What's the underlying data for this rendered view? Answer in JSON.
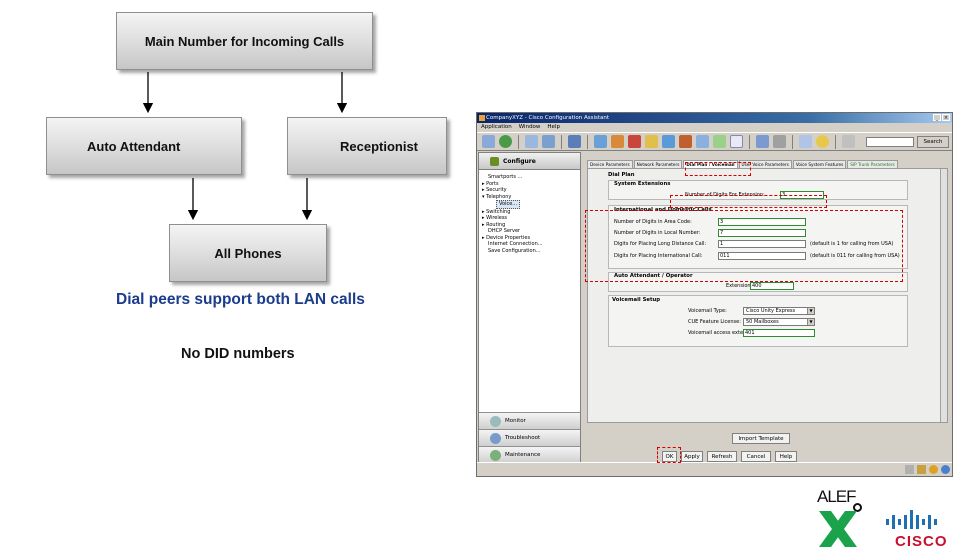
{
  "diagram": {
    "top_box": "Main Number for Incoming Calls",
    "left_box": "Auto Attendant",
    "right_box": "Receptionist",
    "bottom_box": "All Phones",
    "caption_blue": "Dial peers support both LAN calls",
    "caption_black": "No DID numbers"
  },
  "window": {
    "title": "CompanyXYZ - Cisco Configuration Assistant",
    "controls": [
      "_",
      "×"
    ],
    "menu": [
      "Application",
      "Window",
      "Help"
    ],
    "search_label": "Search",
    "nav": {
      "header": "Configure",
      "tree": [
        "Smartports ...",
        "Ports",
        "Security",
        "Telephony",
        "Voice...",
        "Switching",
        "Wireless",
        "Routing",
        "DHCP Server",
        "Device Properties",
        "Internet Connection...",
        "Save Configuration..."
      ],
      "bottom_buttons": [
        "Monitor",
        "Troubleshoot",
        "Maintenance"
      ]
    },
    "tabs": [
      "Device Parameters",
      "Network Parameters",
      "Dial Plan / Voicemail",
      "User Voice Parameters",
      "Voice System Features",
      "SIP Trunk Parameters"
    ],
    "active_tab_index": 2,
    "panel": {
      "section_title": "Dial Plan",
      "system_extensions": {
        "title": "System Extensions",
        "digits_label": "Number of Digits For Extension:",
        "digits_value": "3"
      },
      "intl_domestic": {
        "title": "International and Domestic Calls",
        "area_code_label": "Number of Digits in Area Code:",
        "area_code_value": "3",
        "local_number_label": "Number of Digits in Local Number:",
        "local_number_value": "7",
        "long_distance_label": "Digits for Placing Long Distance Call:",
        "long_distance_value": "1",
        "long_distance_note": "(default is 1 for calling from USA)",
        "international_label": "Digits for Placing International Call:",
        "international_value": "011",
        "international_note": "(default is 011 for calling from USA)"
      },
      "auto_attendant": {
        "title": "Auto Attendant / Operator",
        "extension_label": "Extension:",
        "extension_value": "400"
      },
      "voicemail": {
        "title": "Voicemail Setup",
        "type_label": "Voicemail Type:",
        "type_value": "Cisco Unity Express",
        "license_label": "CUE Feature License:",
        "license_value": "50 Mailboxes",
        "access_label": "Voicemail access extension:",
        "access_value": "401"
      }
    },
    "import_button": "Import Template",
    "buttons": [
      "OK",
      "Apply",
      "Refresh",
      "Cancel",
      "Help"
    ]
  },
  "logos": {
    "alef": "ALEF",
    "cisco": "CISCO"
  },
  "colors": {
    "blue_caption": "#1a3c8c",
    "annotation_red": "#d40000",
    "field_green": "#2e8b2e",
    "alef_green": "#1aa34a"
  }
}
